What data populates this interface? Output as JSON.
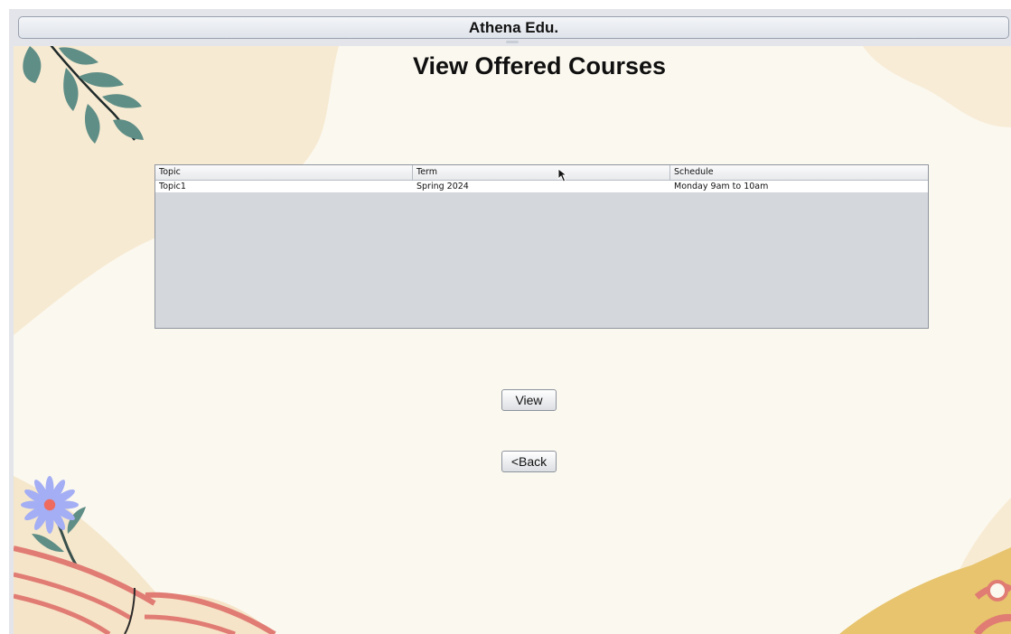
{
  "window": {
    "title": "Athena Edu."
  },
  "page": {
    "title": "View Offered Courses"
  },
  "table": {
    "columns": [
      "Topic",
      "Term",
      "Schedule"
    ],
    "rows": [
      {
        "topic": "Topic1",
        "term": "Spring 2024",
        "schedule": "Monday 9am to 10am"
      }
    ]
  },
  "buttons": {
    "view": "View",
    "back": "<Back"
  },
  "colors": {
    "background": "#fbf8ef",
    "blob": "#f7ead2",
    "leaf": "#5f8e86",
    "flower": "#a4aef4",
    "book_red": "#e07c73",
    "book_yellow": "#e7c46d"
  },
  "icons": {
    "cursor": "mouse-pointer-icon",
    "leaf_branch": "leaf-branch-icon",
    "flower": "flower-icon",
    "book": "open-book-icon"
  }
}
